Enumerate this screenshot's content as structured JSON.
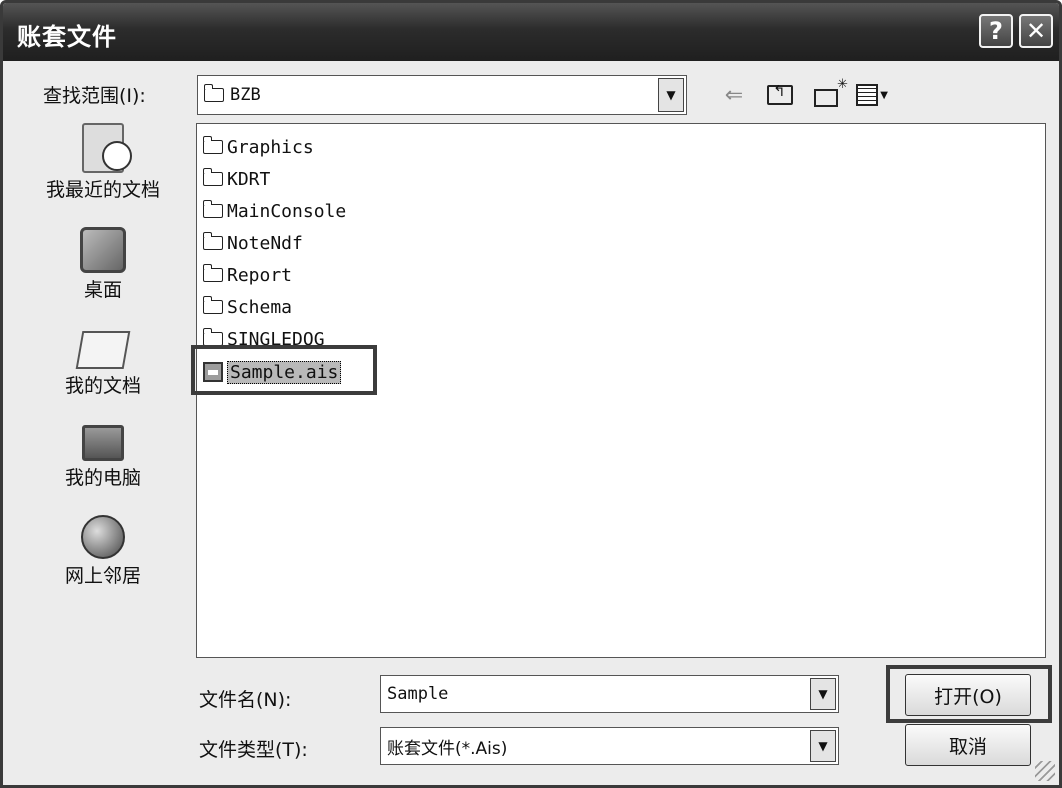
{
  "window": {
    "title": "账套文件",
    "help_label": "?",
    "close_label": "✕"
  },
  "look_in": {
    "label": "查找范围(I):",
    "value": "BZB"
  },
  "places": [
    {
      "label": "我最近的文档",
      "icon": "recent-documents-icon"
    },
    {
      "label": "桌面",
      "icon": "desktop-icon"
    },
    {
      "label": "我的文档",
      "icon": "my-documents-icon"
    },
    {
      "label": "我的电脑",
      "icon": "my-computer-icon"
    },
    {
      "label": "网上邻居",
      "icon": "network-places-icon"
    }
  ],
  "files": [
    {
      "name": "Graphics",
      "type": "folder"
    },
    {
      "name": "KDRT",
      "type": "folder"
    },
    {
      "name": "MainConsole",
      "type": "folder"
    },
    {
      "name": "NoteNdf",
      "type": "folder"
    },
    {
      "name": "Report",
      "type": "folder"
    },
    {
      "name": "Schema",
      "type": "folder"
    },
    {
      "name": "SINGLEDOG",
      "type": "folder"
    },
    {
      "name": "Sample.ais",
      "type": "file",
      "selected": true
    }
  ],
  "filename": {
    "label": "文件名(N):",
    "value": "Sample"
  },
  "filetype": {
    "label": "文件类型(T):",
    "value": "账套文件(*.Ais)"
  },
  "buttons": {
    "open": "打开(O)",
    "cancel": "取消"
  }
}
